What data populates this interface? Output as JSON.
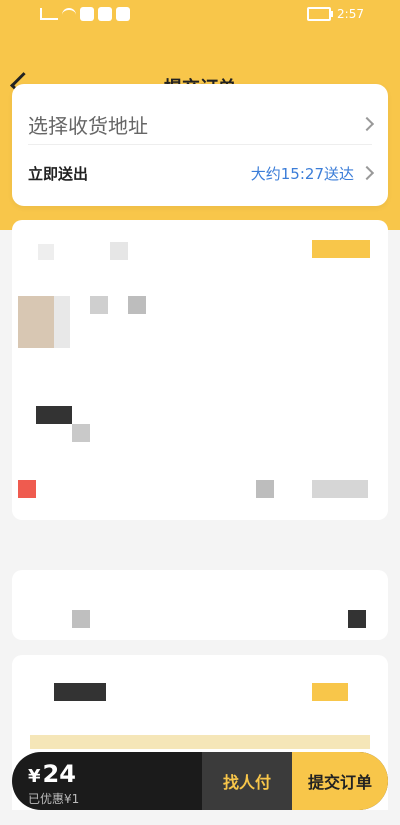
{
  "status": {
    "time": "2:57",
    "icons": [
      "signal-icon",
      "wifi-icon",
      "app-icon",
      "battery-icon"
    ]
  },
  "header": {
    "title": "提交订单",
    "back_icon": "chevron-left-icon"
  },
  "address": {
    "placeholder": "选择收货地址",
    "delivery_label": "立即送出",
    "delivery_time": "大约15:27送达"
  },
  "bottom_bar": {
    "currency": "¥",
    "amount": "24",
    "discount": "已优惠¥1",
    "find_friend_label": "找人付",
    "submit_label": "提交订单"
  },
  "colors": {
    "accent": "#f8c64a",
    "link": "#3b7dd8",
    "bar_dark": "#1b1b1b"
  }
}
